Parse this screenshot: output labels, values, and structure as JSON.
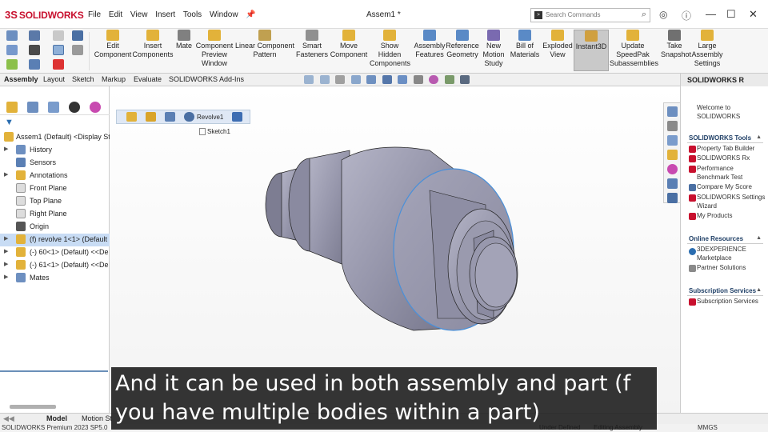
{
  "app": {
    "logo_prefix": "3S",
    "logo_text": "SOLIDWORKS",
    "doc_title": "Assem1 *"
  },
  "menu": [
    "File",
    "Edit",
    "View",
    "Insert",
    "Tools",
    "Window"
  ],
  "search": {
    "placeholder": "Search Commands"
  },
  "ribbon": [
    {
      "label": "Edit\nComponent",
      "icon": "edit-component-icon",
      "color": "#e2b23a"
    },
    {
      "label": "Insert\nComponents",
      "icon": "insert-components-icon",
      "color": "#e2b23a"
    },
    {
      "label": "Mate",
      "icon": "mate-icon",
      "color": "#808080"
    },
    {
      "label": "Component\nPreview\nWindow",
      "icon": "component-preview-icon",
      "color": "#e2b23a"
    },
    {
      "label": "Linear Component\nPattern",
      "icon": "linear-pattern-icon",
      "color": "#c0a050"
    },
    {
      "label": "Smart\nFasteners",
      "icon": "smart-fasteners-icon",
      "color": "#909090"
    },
    {
      "label": "Move\nComponent",
      "icon": "move-component-icon",
      "color": "#e2b23a"
    },
    {
      "label": "Show\nHidden\nComponents",
      "icon": "show-hidden-icon",
      "color": "#e2b23a"
    },
    {
      "label": "Assembly\nFeatures",
      "icon": "assembly-features-icon",
      "color": "#5a8ac6"
    },
    {
      "label": "Reference\nGeometry",
      "icon": "reference-geometry-icon",
      "color": "#5a8ac6"
    },
    {
      "label": "New\nMotion\nStudy",
      "icon": "motion-study-icon",
      "color": "#7a6ab0"
    },
    {
      "label": "Bill of\nMaterials",
      "icon": "bom-icon",
      "color": "#5a8ac6"
    },
    {
      "label": "Exploded\nView",
      "icon": "exploded-view-icon",
      "color": "#e2b23a"
    },
    {
      "label": "Instant3D",
      "icon": "instant3d-icon",
      "color": "#d0a040"
    },
    {
      "label": "Update\nSpeedPak\nSubassemblies",
      "icon": "speedpak-icon",
      "color": "#e2b23a"
    },
    {
      "label": "Take\nSnapshot",
      "icon": "snapshot-icon",
      "color": "#707070"
    },
    {
      "label": "Large\nAssembly\nSettings",
      "icon": "large-assembly-icon",
      "color": "#e2b23a"
    }
  ],
  "tabs": [
    "Assembly",
    "Layout",
    "Sketch",
    "Markup",
    "Evaluate",
    "SOLIDWORKS Add-Ins"
  ],
  "tree": [
    {
      "label": "Assem1 (Default) <Display St",
      "icon": "assembly-icon",
      "arrow": ""
    },
    {
      "label": "History",
      "icon": "history-icon",
      "arrow": "▶"
    },
    {
      "label": "Sensors",
      "icon": "sensors-icon",
      "arrow": ""
    },
    {
      "label": "Annotations",
      "icon": "annotations-icon",
      "arrow": "▶"
    },
    {
      "label": "Front Plane",
      "icon": "plane-icon",
      "arrow": ""
    },
    {
      "label": "Top Plane",
      "icon": "plane-icon",
      "arrow": ""
    },
    {
      "label": "Right Plane",
      "icon": "plane-icon",
      "arrow": ""
    },
    {
      "label": "Origin",
      "icon": "origin-icon",
      "arrow": ""
    },
    {
      "label": "(f) revolve 1<1> (Default",
      "icon": "part-icon",
      "arrow": "▶"
    },
    {
      "label": "(-) 60<1> (Default) <<De",
      "icon": "part-icon",
      "arrow": "▶"
    },
    {
      "label": "(-) 61<1> (Default) <<De",
      "icon": "part-icon",
      "arrow": "▶"
    },
    {
      "label": "Mates",
      "icon": "mates-icon",
      "arrow": "▶"
    }
  ],
  "breadcrumb": {
    "feature": "Revolve1",
    "sketch": "Sketch1"
  },
  "bottom_tabs": [
    "Model",
    "Motion St"
  ],
  "status": {
    "left": "SOLIDWORKS Premium 2023 SP5.0",
    "mid1": "Under Defined",
    "mid2": "Editing Assembly",
    "right": "MMGS"
  },
  "task_pane": {
    "header": "SOLIDWORKS R",
    "welcome": "Welcome to\nSOLIDWORKS",
    "tools_title": "SOLIDWORKS Tools",
    "tools": [
      "Property Tab Builder",
      "SOLIDWORKS Rx",
      "Performance\nBenchmark Test",
      "Compare My Score",
      "SOLIDWORKS Settings\nWizard",
      "My Products"
    ],
    "online_title": "Online Resources",
    "online": [
      "3DEXPERIENCE\nMarketplace",
      "Partner Solutions"
    ],
    "subs_title": "Subscription Services",
    "subs": [
      "Subscription Services"
    ]
  },
  "subtitle": "And it can be used in both assembly and part (f\nyou have multiple bodies within a part)",
  "colors": {
    "part_fill": "#8f8fa6",
    "edge_highlight": "#4a90d9",
    "selection": "#c8dcf4",
    "brand": "#c8102e"
  }
}
